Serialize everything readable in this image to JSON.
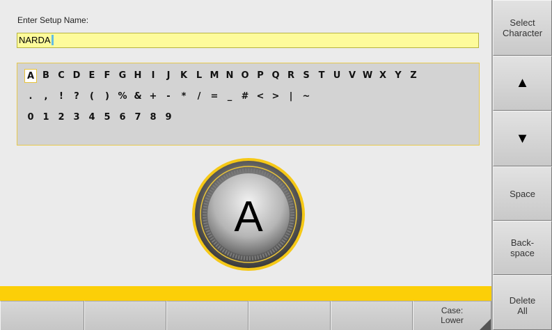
{
  "prompt_label": "Enter Setup Name:",
  "name_value": "NARDA",
  "char_rows": [
    [
      "A",
      "B",
      "C",
      "D",
      "E",
      "F",
      "G",
      "H",
      "I",
      "J",
      "K",
      "L",
      "M",
      "N",
      "O",
      "P",
      "Q",
      "R",
      "S",
      "T",
      "U",
      "V",
      "W",
      "X",
      "Y",
      "Z"
    ],
    [
      ".",
      ",",
      "!",
      "?",
      "(",
      ")",
      "%",
      "&",
      "+",
      "-",
      "*",
      "/",
      "=",
      "_",
      "#",
      "<",
      ">",
      "|",
      "~"
    ],
    [
      "0",
      "1",
      "2",
      "3",
      "4",
      "5",
      "6",
      "7",
      "8",
      "9"
    ]
  ],
  "selected_char": "A",
  "dial_char": "A",
  "softkeys": [
    "",
    "",
    "",
    "",
    "",
    "Case:\nLower"
  ],
  "sidebar": {
    "select_character": "Select\nCharacter",
    "up_icon": "▲",
    "down_icon": "▼",
    "space": "Space",
    "backspace": "Back-\nspace",
    "delete_all": "Delete\nAll"
  },
  "colors": {
    "accent_yellow": "#fccf08",
    "field_bg": "#fdfb9b",
    "panel_border": "#e6c84c",
    "cursor": "#62bce6"
  }
}
